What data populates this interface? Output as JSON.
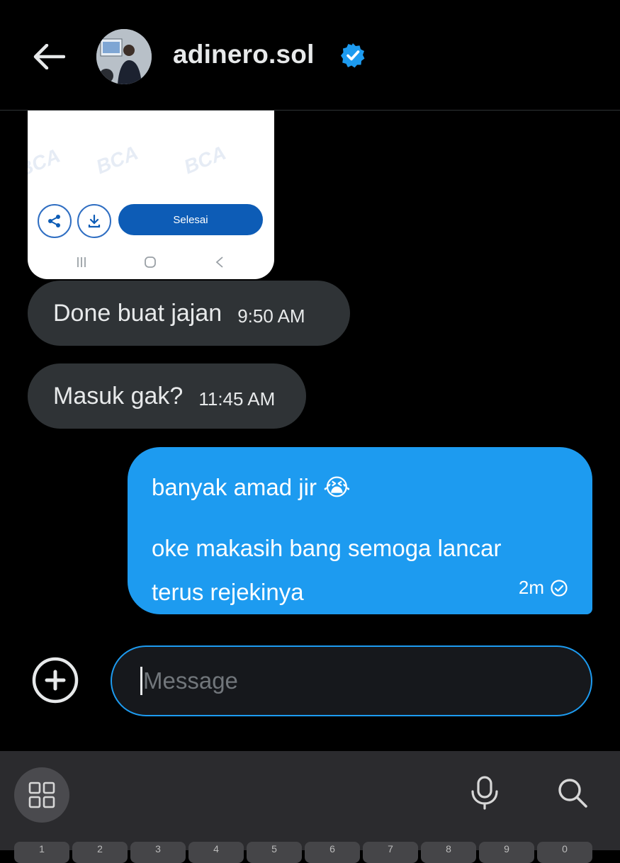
{
  "header": {
    "username": "adinero.sol",
    "verified_icon": "verified-badge-icon",
    "back_icon": "arrow-left-icon"
  },
  "image_attachment": {
    "watermark": "BCA",
    "button_label": "Selesai",
    "icons": [
      "share-icon",
      "download-icon",
      "recents-icon",
      "home-icon",
      "back-icon"
    ]
  },
  "messages": [
    {
      "direction": "incoming",
      "text": "Done buat jajan",
      "time": "9:50 AM"
    },
    {
      "direction": "incoming",
      "text": "Masuk gak?",
      "time": "11:45 AM"
    },
    {
      "direction": "outgoing",
      "lines": [
        "banyak amad jir 😭",
        "",
        "oke makasih bang semoga lancar",
        "terus rejekinya"
      ],
      "time": "2m",
      "status_icon": "check-circle-icon"
    }
  ],
  "composer": {
    "placeholder": "Message",
    "add_icon": "plus-circle-icon"
  },
  "keyboard": {
    "icons": [
      "apps-grid-icon",
      "microphone-icon",
      "search-icon"
    ],
    "top_row": [
      "1",
      "2",
      "3",
      "4",
      "5",
      "6",
      "7",
      "8",
      "9",
      "0"
    ]
  },
  "colors": {
    "accent": "#1d9bf0",
    "incoming_bubble": "#2f3336",
    "background": "#000000",
    "keyboard": "#2b2b2e"
  }
}
